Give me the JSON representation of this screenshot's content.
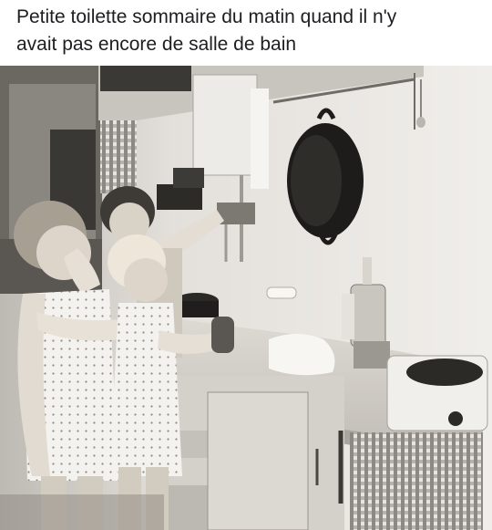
{
  "post": {
    "caption_line1": "Petite toilette sommaire du matin quand il n'y",
    "caption_line2": "avait pas encore de salle de bain"
  },
  "photo": {
    "style": "black-and-white vintage photograph",
    "colors": {
      "wall": "#e6e3de",
      "shadow": "#2a2825",
      "counter": "#d9d5cf",
      "pan": "#1d1c1a"
    }
  }
}
